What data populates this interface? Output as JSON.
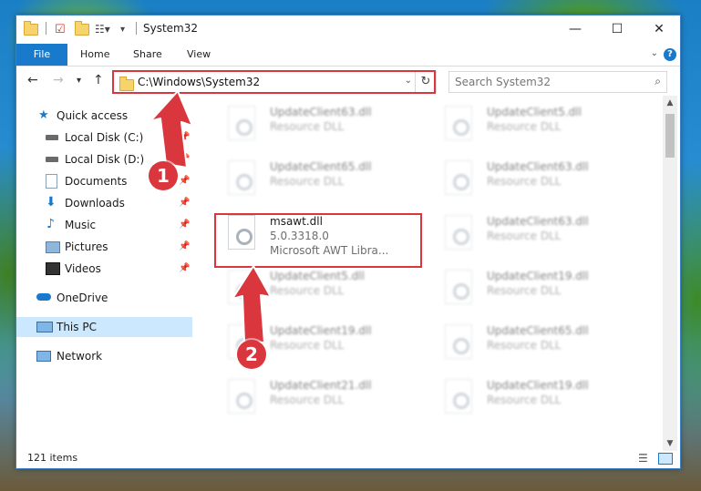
{
  "title": "System32",
  "window_buttons": {
    "minimize": "—",
    "maximize": "☐",
    "close": "✕"
  },
  "ribbon": {
    "file": "File",
    "home": "Home",
    "share": "Share",
    "view": "View",
    "help": "?"
  },
  "address": {
    "path": "C:\\Windows\\System32"
  },
  "search": {
    "placeholder": "Search System32"
  },
  "sidebar": {
    "items": [
      {
        "label": "Quick access"
      },
      {
        "label": "Local Disk (C:)"
      },
      {
        "label": "Local Disk (D:)"
      },
      {
        "label": "Documents"
      },
      {
        "label": "Downloads"
      },
      {
        "label": "Music"
      },
      {
        "label": "Pictures"
      },
      {
        "label": "Videos"
      },
      {
        "label": "OneDrive"
      },
      {
        "label": "This PC"
      },
      {
        "label": "Network"
      }
    ]
  },
  "files": [
    {
      "name": "UpdateClient63.dll",
      "type": "Resource DLL"
    },
    {
      "name": "UpdateClient5.dll",
      "type": "Resource DLL"
    },
    {
      "name": "UpdateClient65.dll",
      "type": "Resource DLL"
    },
    {
      "name": "UpdateClient63.dll",
      "type": "Resource DLL"
    },
    {
      "name": "msawt.dll",
      "version": "5.0.3318.0",
      "description": "Microsoft AWT Libra..."
    },
    {
      "name": "UpdateClient63.dll",
      "type": "Resource DLL"
    },
    {
      "name": "UpdateClient5.dll",
      "type": "Resource DLL"
    },
    {
      "name": "UpdateClient19.dll",
      "type": "Resource DLL"
    },
    {
      "name": "UpdateClient19.dll",
      "type": "Resource DLL"
    },
    {
      "name": "UpdateClient65.dll",
      "type": "Resource DLL"
    },
    {
      "name": "UpdateClient21.dll",
      "type": "Resource DLL"
    },
    {
      "name": "UpdateClient19.dll",
      "type": "Resource DLL"
    }
  ],
  "status": {
    "item_count": "121 items"
  },
  "callouts": {
    "one": "1",
    "two": "2"
  },
  "colors": {
    "accent": "#1979ca",
    "highlight": "#d9363e",
    "selected": "#cce8ff"
  }
}
